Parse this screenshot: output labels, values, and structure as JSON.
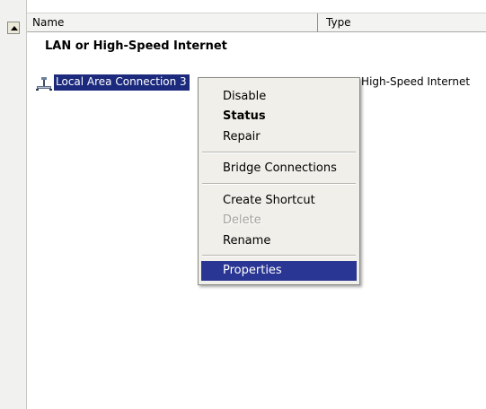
{
  "columns": {
    "name": "Name",
    "type": "Type"
  },
  "group": {
    "title": "LAN or High-Speed Internet"
  },
  "connection": {
    "name": "Local Area Connection 3",
    "type": "LAN or High-Speed Internet",
    "icon": "network-connection-icon"
  },
  "context_menu": {
    "items": [
      {
        "label": "Disable"
      },
      {
        "label": "Status"
      },
      {
        "label": "Repair"
      },
      {
        "label": "Bridge Connections"
      },
      {
        "label": "Create Shortcut"
      },
      {
        "label": "Delete"
      },
      {
        "label": "Rename"
      },
      {
        "label": "Properties"
      }
    ]
  },
  "colors": {
    "selection": "#1c2a7d",
    "menu_highlight": "#2a3693",
    "menu_background": "#f0efe9"
  }
}
